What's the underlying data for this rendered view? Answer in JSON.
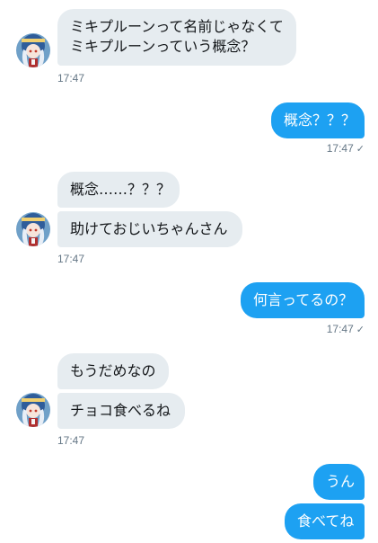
{
  "conversation": {
    "m1": {
      "lines": [
        "ミキプルーンって名前じゃなくて",
        "ミキプルーンっていう概念？"
      ],
      "time": "17:47"
    },
    "m2": {
      "text": "概念？？？",
      "time": "17:47",
      "status": "✓"
    },
    "m3": {
      "text": "概念……？？？"
    },
    "m4": {
      "text": "助けておじいちゃんさん",
      "time": "17:47"
    },
    "m5": {
      "text": "何言ってるの？",
      "time": "17:47",
      "status": "✓"
    },
    "m6": {
      "text": "もうだめなの"
    },
    "m7": {
      "text": "チョコ食べるね",
      "time": "17:47"
    },
    "m8": {
      "text": "うん"
    },
    "m9": {
      "text": "食べてね"
    }
  },
  "avatar": {
    "icon": "anime-character-avatar-icon"
  },
  "colors": {
    "incoming_bg": "#e6ecf0",
    "outgoing_bg": "#1da1f2",
    "timestamp": "#657786"
  }
}
